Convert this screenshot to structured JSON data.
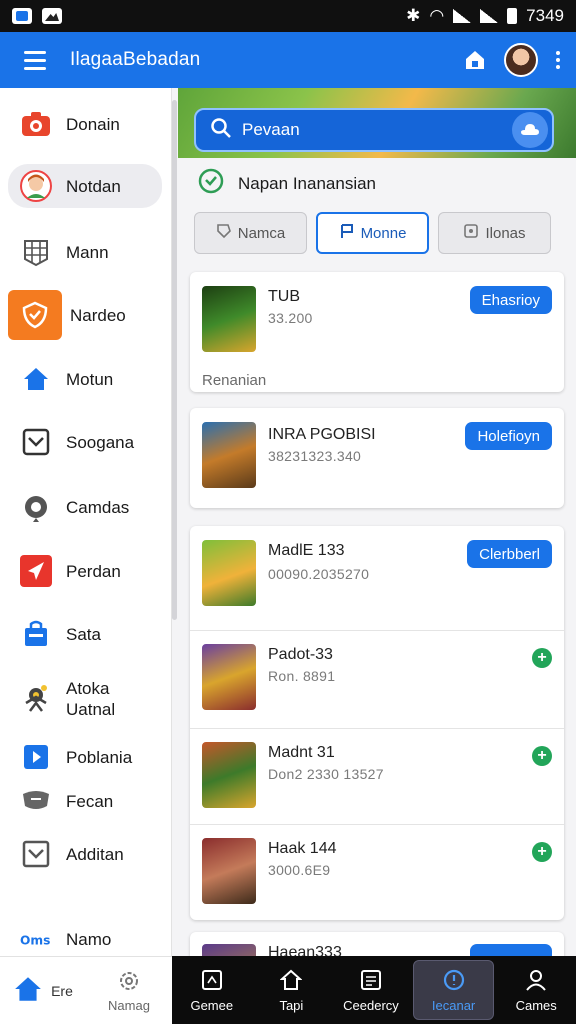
{
  "status_bar": {
    "time": "7349"
  },
  "app_bar": {
    "title": "IlagaaBebadan"
  },
  "sidebar": {
    "items": [
      {
        "label": "Donain",
        "icon": "camera-icon"
      },
      {
        "label": "Notdan",
        "icon": "avatar-icon"
      },
      {
        "label": "Mann",
        "icon": "grid-icon"
      },
      {
        "label": "Nardeo",
        "icon": "shield-icon"
      },
      {
        "label": "Motun",
        "icon": "home-icon"
      },
      {
        "label": "Soogana",
        "icon": "checkbox-icon"
      },
      {
        "label": "Camdas",
        "icon": "settings-icon"
      },
      {
        "label": "Perdan",
        "icon": "send-icon"
      },
      {
        "label": "Sata",
        "icon": "bag-icon"
      },
      {
        "label": "Atoka Uatnal",
        "icon": "drone-icon"
      },
      {
        "label": "Poblania",
        "icon": "play-icon"
      },
      {
        "label": "Fecan",
        "icon": "chat-icon"
      },
      {
        "label": "Additan",
        "icon": "checkbox-icon"
      },
      {
        "label": "Namo",
        "icon": "logo-icon"
      }
    ],
    "bottom": [
      {
        "label": "Ere",
        "icon": "home-icon"
      },
      {
        "label": "Namag",
        "icon": "gear-icon"
      }
    ]
  },
  "search": {
    "placeholder": "Pevaan"
  },
  "section": {
    "title": "Napan Inanansian"
  },
  "tabs": [
    {
      "label": "Namca",
      "icon": "tag-icon"
    },
    {
      "label": "Monne",
      "icon": "flag-icon"
    },
    {
      "label": "Ilonas",
      "icon": "list-icon"
    }
  ],
  "items": [
    {
      "title": "TUB",
      "sub": "33.200",
      "action": "Ehasrioy",
      "foot": "Renanian"
    },
    {
      "title": "INRA PGOBISI",
      "sub": "38231323.340",
      "action": "Holefioyn"
    },
    {
      "title": "MadlE 133",
      "sub": "00090.2035270",
      "action": "Clerbberl"
    },
    {
      "title": "Padot-33",
      "sub": "Ron. 8891"
    },
    {
      "title": "Madnt 31",
      "sub": "Don2 2330 13527"
    },
    {
      "title": "Haak 144",
      "sub": "3000.6E9"
    },
    {
      "title": "Haean333"
    }
  ],
  "bottom_nav": [
    {
      "label": "Gemee",
      "icon": "game-icon"
    },
    {
      "label": "Tapi",
      "icon": "home-icon"
    },
    {
      "label": "Ceedercy",
      "icon": "list-icon"
    },
    {
      "label": "Iecanar",
      "icon": "info-icon"
    },
    {
      "label": "Cames",
      "icon": "profile-icon"
    }
  ],
  "colors": {
    "primary": "#1a73e8",
    "success": "#22a559",
    "nav_bg": "#0c0c0c"
  }
}
